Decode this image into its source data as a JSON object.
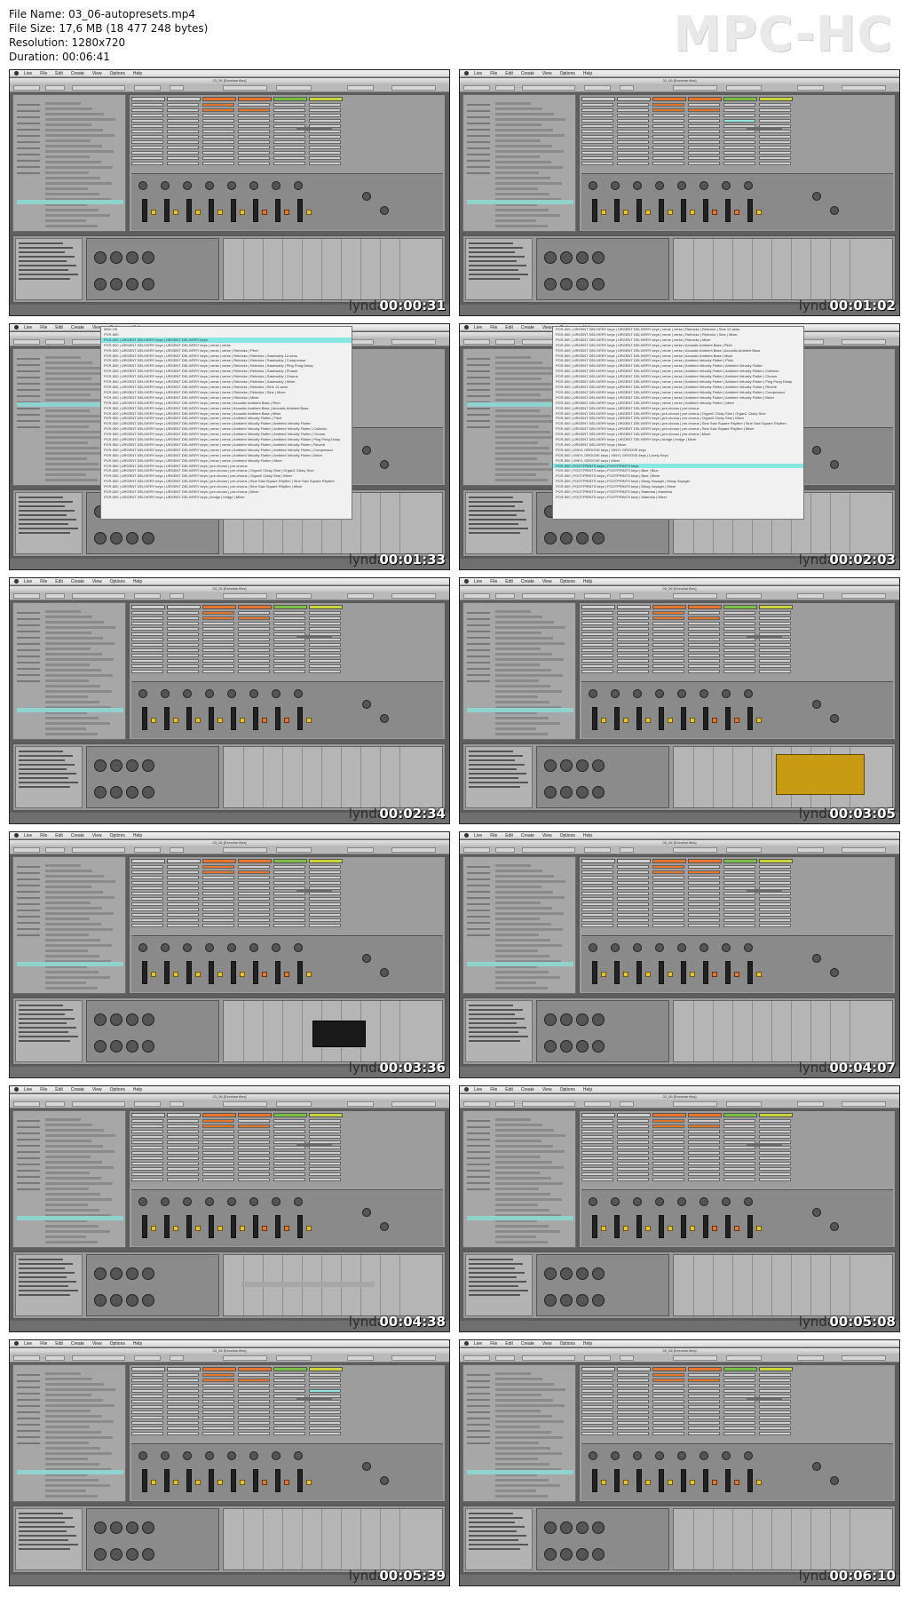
{
  "header": {
    "file_name": "File Name: 03_06-autopresets.mp4",
    "file_size": "File Size: 17,6 MB (18 477 248 bytes)",
    "resolution": "Resolution: 1280x720",
    "duration": "Duration: 00:06:41",
    "brand": "MPC-HC"
  },
  "app": {
    "menu": [
      "Live",
      "File",
      "Edit",
      "Create",
      "View",
      "Options",
      "Help"
    ],
    "window_title": "03_06 [Exercise files]",
    "watermark": "lynda"
  },
  "frames": [
    {
      "time": "00:00:31",
      "variant": "browser-help"
    },
    {
      "time": "00:01:02",
      "variant": "clip-select"
    },
    {
      "time": "00:01:33",
      "variant": "popup-list"
    },
    {
      "time": "00:02:03",
      "variant": "popup-list-2"
    },
    {
      "time": "00:02:34",
      "variant": "normal"
    },
    {
      "time": "00:03:05",
      "variant": "sampler"
    },
    {
      "time": "00:03:36",
      "variant": "effects"
    },
    {
      "time": "00:04:07",
      "variant": "normal"
    },
    {
      "time": "00:04:38",
      "variant": "arrangement"
    },
    {
      "time": "00:05:08",
      "variant": "normal"
    },
    {
      "time": "00:05:39",
      "variant": "selected-row"
    },
    {
      "time": "00:06:10",
      "variant": "normal"
    }
  ],
  "popup_a": {
    "items": [
      "MIDI Off",
      "PCR-500",
      "PCR-500 | URGENT DELIVERY keys | URGENT DELIVERY keys",
      "PCR-500 | URGENT DELIVERY keys | URGENT DELIVERY keys | verse | verse",
      "PCR-500 | URGENT DELIVERY keys | URGENT DELIVERY keys | verse | verse | Rebrickz | Pitch",
      "PCR-500 | URGENT DELIVERY keys | URGENT DELIVERY keys | verse | verse | Rebrickz | Rebrickz | Sawbuddy 12-sens",
      "PCR-500 | URGENT DELIVERY keys | URGENT DELIVERY keys | verse | verse | Rebrickz | Rebrickz | Sawbuddy | Compressor",
      "PCR-500 | URGENT DELIVERY keys | URGENT DELIVERY keys | verse | verse | Rebrickz | Rebrickz | Sawbuddy | Ping Pong Delay",
      "PCR-500 | URGENT DELIVERY keys | URGENT DELIVERY keys | verse | verse | Rebrickz | Rebrickz | Sawbuddy | Phaser",
      "PCR-500 | URGENT DELIVERY keys | URGENT DELIVERY keys | verse | verse | Rebrickz | Rebrickz | Sawbuddy | Chorus",
      "PCR-500 | URGENT DELIVERY keys | URGENT DELIVERY keys | verse | verse | Rebrickz | Rebrickz | Sawbuddy | Mixer",
      "PCR-500 | URGENT DELIVERY keys | URGENT DELIVERY keys | verse | verse | Rebrickz | Rebrickz | Sine 12-sens",
      "PCR-500 | URGENT DELIVERY keys | URGENT DELIVERY keys | verse | verse | Rebrickz | Rebrickz | Sine | Mixer",
      "PCR-500 | URGENT DELIVERY keys | URGENT DELIVERY keys | verse | verse | Rebrickz | Mixer",
      "PCR-500 | URGENT DELIVERY keys | URGENT DELIVERY keys | verse | verse | Acoustic Ambient Bass | Pitch",
      "PCR-500 | URGENT DELIVERY keys | URGENT DELIVERY keys | verse | verse | Acoustic Ambient Bass | Acoustic Ambient Bass",
      "PCR-500 | URGENT DELIVERY keys | URGENT DELIVERY keys | verse | verse | Acoustic Ambient Bass | Mixer",
      "PCR-500 | URGENT DELIVERY keys | URGENT DELIVERY keys | verse | verse | Ambient Velocity Flutter | Pitch",
      "PCR-500 | URGENT DELIVERY keys | URGENT DELIVERY keys | verse | verse | Ambient Velocity Flutter | Ambient Velocity Flutter",
      "PCR-500 | URGENT DELIVERY keys | URGENT DELIVERY keys | verse | verse | Ambient Velocity Flutter | Ambient Velocity Flutter | Collision",
      "PCR-500 | URGENT DELIVERY keys | URGENT DELIVERY keys | verse | verse | Ambient Velocity Flutter | Ambient Velocity Flutter | Chorus",
      "PCR-500 | URGENT DELIVERY keys | URGENT DELIVERY keys | verse | verse | Ambient Velocity Flutter | Ambient Velocity Flutter | Ping Pong Delay",
      "PCR-500 | URGENT DELIVERY keys | URGENT DELIVERY keys | verse | verse | Ambient Velocity Flutter | Ambient Velocity Flutter | Reverb",
      "PCR-500 | URGENT DELIVERY keys | URGENT DELIVERY keys | verse | verse | Ambient Velocity Flutter | Ambient Velocity Flutter | Compressor",
      "PCR-500 | URGENT DELIVERY keys | URGENT DELIVERY keys | verse | verse | Ambient Velocity Flutter | Ambient Velocity Flutter | Mixer",
      "PCR-500 | URGENT DELIVERY keys | URGENT DELIVERY keys | verse | verse | Ambient Velocity Flutter | Mixer",
      "PCR-500 | URGENT DELIVERY keys | URGENT DELIVERY keys | pre-chorus | pre-chorus",
      "PCR-500 | URGENT DELIVERY keys | URGENT DELIVERY keys | pre-chorus | pre-chorus | Organ2 Clicky Sine | Organ2 Clicky Sine",
      "PCR-500 | URGENT DELIVERY keys | URGENT DELIVERY keys | pre-chorus | pre-chorus | Organ2 Clicky Sine | Mixer",
      "PCR-500 | URGENT DELIVERY keys | URGENT DELIVERY keys | pre-chorus | pre-chorus | Sine Saw Square Rhythm | Sine Saw Square Rhythm",
      "PCR-500 | URGENT DELIVERY keys | URGENT DELIVERY keys | pre-chorus | pre-chorus | Sine Saw Square Rhythm | Mixer",
      "PCR-500 | URGENT DELIVERY keys | URGENT DELIVERY keys | pre-chorus | pre-chorus | Mixer",
      "PCR-500 | URGENT DELIVERY keys | URGENT DELIVERY keys | bridge | bridge | Mixer"
    ],
    "selected_index": 2
  },
  "popup_b": {
    "items": [
      "PCR-500 | URGENT DELIVERY keys | URGENT DELIVERY keys | verse | verse | Rebrickz | Rebrickz | Sine 12-sens",
      "PCR-500 | URGENT DELIVERY keys | URGENT DELIVERY keys | verse | verse | Rebrickz | Rebrickz | Sine | Mixer",
      "PCR-500 | URGENT DELIVERY keys | URGENT DELIVERY keys | verse | verse | Rebrickz | Mixer",
      "PCR-500 | URGENT DELIVERY keys | URGENT DELIVERY keys | verse | verse | Acoustic Ambient Bass | Pitch",
      "PCR-500 | URGENT DELIVERY keys | URGENT DELIVERY keys | verse | verse | Acoustic Ambient Bass | Acoustic Ambient Bass",
      "PCR-500 | URGENT DELIVERY keys | URGENT DELIVERY keys | verse | verse | Acoustic Ambient Bass | Mixer",
      "PCR-500 | URGENT DELIVERY keys | URGENT DELIVERY keys | verse | verse | Ambient Velocity Flutter | Pitch",
      "PCR-500 | URGENT DELIVERY keys | URGENT DELIVERY keys | verse | verse | Ambient Velocity Flutter | Ambient Velocity Flutter",
      "PCR-500 | URGENT DELIVERY keys | URGENT DELIVERY keys | verse | verse | Ambient Velocity Flutter | Ambient Velocity Flutter | Collision",
      "PCR-500 | URGENT DELIVERY keys | URGENT DELIVERY keys | verse | verse | Ambient Velocity Flutter | Ambient Velocity Flutter | Chorus",
      "PCR-500 | URGENT DELIVERY keys | URGENT DELIVERY keys | verse | verse | Ambient Velocity Flutter | Ambient Velocity Flutter | Ping Pong Delay",
      "PCR-500 | URGENT DELIVERY keys | URGENT DELIVERY keys | verse | verse | Ambient Velocity Flutter | Ambient Velocity Flutter | Reverb",
      "PCR-500 | URGENT DELIVERY keys | URGENT DELIVERY keys | verse | verse | Ambient Velocity Flutter | Ambient Velocity Flutter | Compressor",
      "PCR-500 | URGENT DELIVERY keys | URGENT DELIVERY keys | verse | verse | Ambient Velocity Flutter | Ambient Velocity Flutter | Mixer",
      "PCR-500 | URGENT DELIVERY keys | URGENT DELIVERY keys | verse | verse | Ambient Velocity Flutter | Mixer",
      "PCR-500 | URGENT DELIVERY keys | URGENT DELIVERY keys | pre-chorus | pre-chorus",
      "PCR-500 | URGENT DELIVERY keys | URGENT DELIVERY keys | pre-chorus | pre-chorus | Organ2 Clicky Sine | Organ2 Clicky Sine",
      "PCR-500 | URGENT DELIVERY keys | URGENT DELIVERY keys | pre-chorus | pre-chorus | Organ2 Clicky Sine | Mixer",
      "PCR-500 | URGENT DELIVERY keys | URGENT DELIVERY keys | pre-chorus | pre-chorus | Sine Saw Square Rhythm | Sine Saw Square Rhythm",
      "PCR-500 | URGENT DELIVERY keys | URGENT DELIVERY keys | pre-chorus | pre-chorus | Sine Saw Square Rhythm | Mixer",
      "PCR-500 | URGENT DELIVERY keys | URGENT DELIVERY keys | pre-chorus | pre-chorus | Mixer",
      "PCR-500 | URGENT DELIVERY keys | URGENT DELIVERY keys | bridge | bridge | Mixer",
      "PCR-500 | URGENT DELIVERY keys | Mixer",
      "PCR-500 | VINYL GROOVE keys | VINYL GROOVE keys",
      "PCR-500 | VINYL GROOVE keys | VINYL GROOVE keys | Lovely Keys",
      "PCR-500 | VINYL GROOVE keys | Mixer",
      "PCR-500 | FOOTPRINTS keys | FOOTPRINTS keys",
      "PCR-500 | FOOTPRINTS keys | FOOTPRINTS keys | Blue | Blue",
      "PCR-500 | FOOTPRINTS keys | FOOTPRINTS keys | Blue | Mixer",
      "PCR-500 | FOOTPRINTS keys | FOOTPRINTS keys | Moog Voyager | Moog Voyager",
      "PCR-500 | FOOTPRINTS keys | FOOTPRINTS keys | Moog Voyager | Mixer",
      "PCR-500 | FOOTPRINTS keys | FOOTPRINTS keys | Marimba | Marimba",
      "PCR-500 | FOOTPRINTS keys | FOOTPRINTS keys | Marimba | Mixer"
    ],
    "selected_index": 26
  },
  "colors": {
    "accent_cyan": "#8fe4e0",
    "clip_orange": "#e6762b",
    "clip_yellow": "#e9c229",
    "ui_gray": "#9d9d9d"
  }
}
